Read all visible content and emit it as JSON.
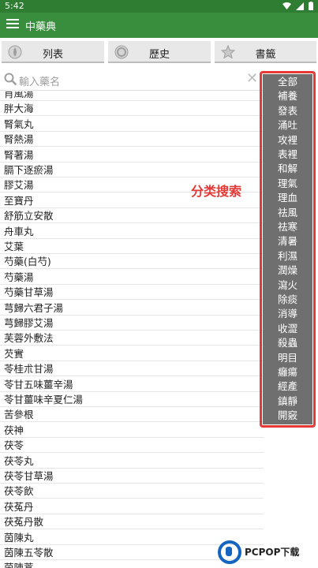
{
  "status_bar": {
    "time": "5:42"
  },
  "app_bar": {
    "title": "中藥典"
  },
  "tabs": [
    {
      "label": "列表",
      "icon": "leaf-icon"
    },
    {
      "label": "歷史",
      "icon": "clock-icon"
    },
    {
      "label": "書籤",
      "icon": "star-icon"
    }
  ],
  "search": {
    "placeholder": "輸入藥名"
  },
  "list": {
    "items": [
      "肖風湯",
      "胖大海",
      "腎氣丸",
      "腎熱湯",
      "腎著湯",
      "膈下逐瘀湯",
      "膠艾湯",
      "至寶丹",
      "舒筋立安散",
      "舟車丸",
      "艾葉",
      "芍藥(白芍)",
      "芍藥湯",
      "芍藥甘草湯",
      "芎歸六君子湯",
      "芎歸膠艾湯",
      "芙蓉外敷法",
      "芡實",
      "苓桂朮甘湯",
      "苓甘五味薑辛湯",
      "苓甘薑味辛夏仁湯",
      "苦參根",
      "茯神",
      "茯苓",
      "茯苓丸",
      "茯苓甘草湯",
      "茯苓飲",
      "茯菟丹",
      "茯菟丹散",
      "茵陳丸",
      "茵陳五苓散",
      "茵陳蒿"
    ]
  },
  "categories": [
    "全部",
    "補養",
    "發表",
    "涌吐",
    "攻裡",
    "表裡",
    "和解",
    "理氣",
    "理血",
    "祛風",
    "祛寒",
    "清暑",
    "利濕",
    "潤燥",
    "瀉火",
    "除痰",
    "消導",
    "收澀",
    "殺蟲",
    "明目",
    "癰瘍",
    "經產",
    "鎮靜",
    "開竅"
  ],
  "annotation": {
    "text": "分类搜索"
  },
  "watermark": {
    "text": "PCPOP下载"
  },
  "colors": {
    "status_bar": "#2e7d32",
    "app_bar": "#388e3c",
    "highlight": "#e53935",
    "panel": "#6f6f6f"
  }
}
